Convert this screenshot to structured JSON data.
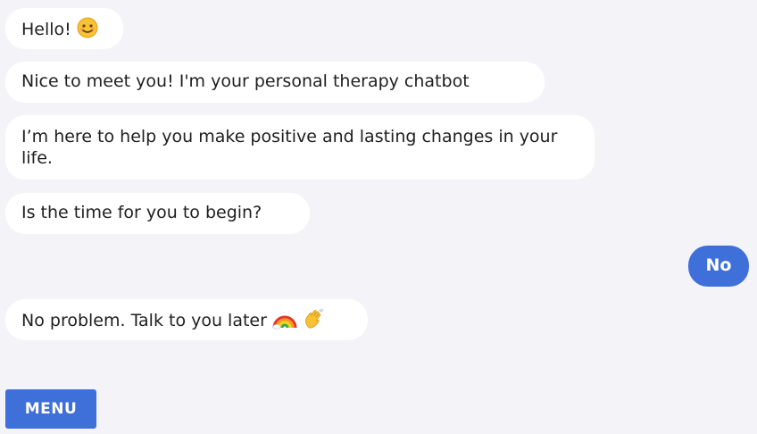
{
  "messages": [
    {
      "role": "bot",
      "text": "Hello!",
      "emoji": "smiling-face-icon"
    },
    {
      "role": "bot",
      "text": "Nice to meet you! I'm your personal therapy chatbot"
    },
    {
      "role": "bot",
      "text": "I’m here to help you make positive and lasting changes in your life."
    },
    {
      "role": "bot",
      "text": "Is the time for you to begin?"
    },
    {
      "role": "user",
      "text": "No"
    },
    {
      "role": "bot",
      "text": "No problem. Talk to you later",
      "emoji": [
        "rainbow-icon",
        "waving-hand-icon"
      ]
    }
  ],
  "menu": {
    "label": "MENU"
  },
  "colors": {
    "background": "#f4f4f8",
    "bot_bubble": "#ffffff",
    "user_bubble": "#3f6fd8",
    "menu_button": "#3f6fd8"
  }
}
